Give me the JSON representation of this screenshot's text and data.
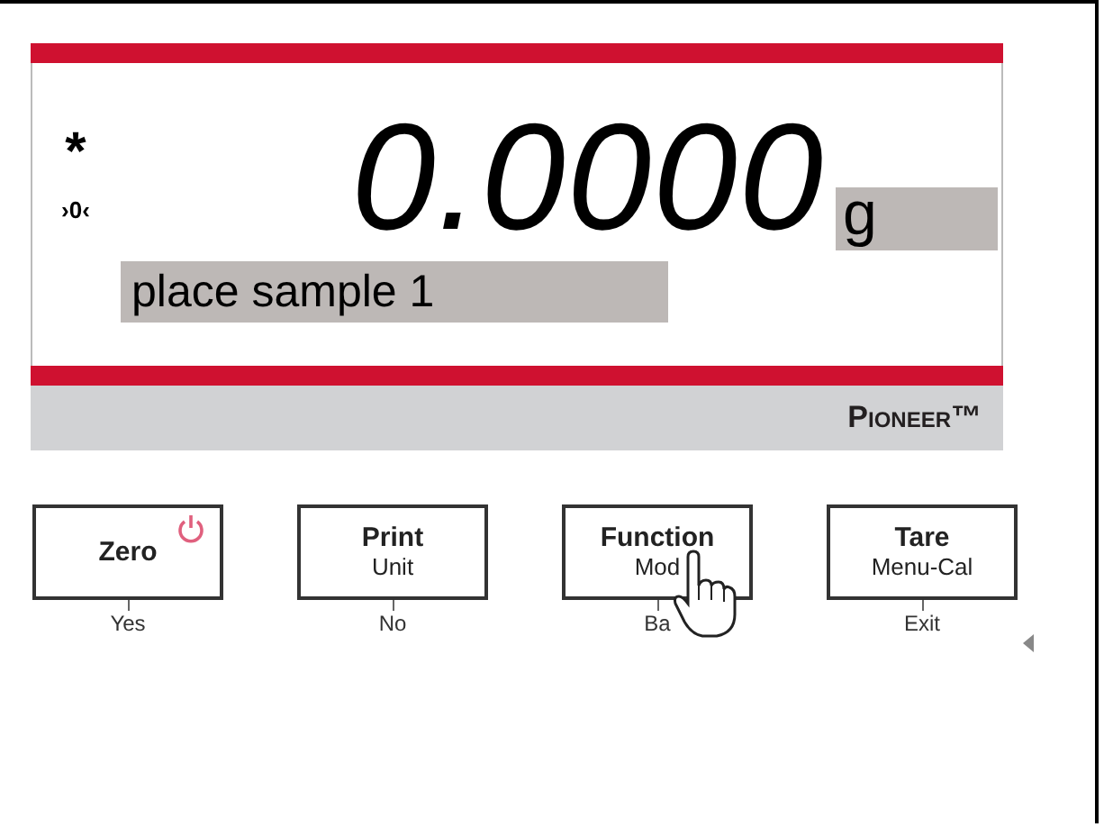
{
  "display": {
    "stability_symbol": "*",
    "zero_symbol": "›0‹",
    "reading": "0.0000",
    "unit": "g",
    "message": "place sample 1"
  },
  "brand": "Pioneer™",
  "keys": [
    {
      "primary": "Zero",
      "below": "Yes",
      "power": true
    },
    {
      "primary": "Print",
      "secondary": "Unit",
      "below": "No",
      "power": false
    },
    {
      "primary": "Function",
      "secondary": "Mod",
      "below": "Ba",
      "power": false
    },
    {
      "primary": "Tare",
      "secondary": "Menu-Cal",
      "below": "Exit",
      "power": false
    }
  ]
}
